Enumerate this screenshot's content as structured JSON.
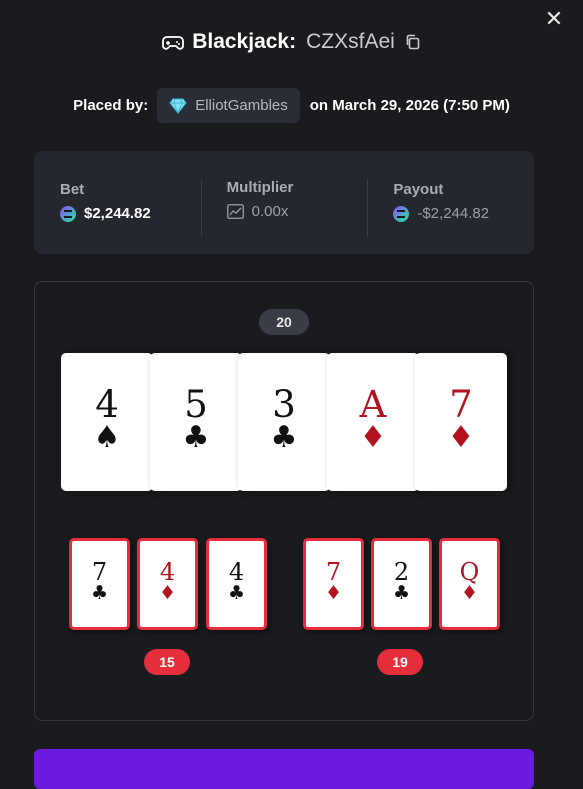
{
  "title": {
    "game": "Blackjack:",
    "id": "CZXsfAei"
  },
  "placed": {
    "prefix": "Placed by:",
    "user": "ElliotGambles",
    "date": "on March 29, 2026 (7:50 PM)"
  },
  "stats": {
    "bet_label": "Bet",
    "bet_value": "$2,244.82",
    "multiplier_label": "Multiplier",
    "multiplier_value": "0.00x",
    "payout_label": "Payout",
    "payout_value": "-$2,244.82"
  },
  "dealer": {
    "total": "20",
    "cards": [
      {
        "rank": "4",
        "suit": "♠",
        "color": "black"
      },
      {
        "rank": "5",
        "suit": "♣",
        "color": "black"
      },
      {
        "rank": "3",
        "suit": "♣",
        "color": "black"
      },
      {
        "rank": "A",
        "suit": "♦",
        "color": "red"
      },
      {
        "rank": "7",
        "suit": "♦",
        "color": "red"
      }
    ]
  },
  "hands": [
    {
      "total": "15",
      "cards": [
        {
          "rank": "7",
          "suit": "♣",
          "color": "black"
        },
        {
          "rank": "4",
          "suit": "♦",
          "color": "red"
        },
        {
          "rank": "4",
          "suit": "♣",
          "color": "black"
        }
      ]
    },
    {
      "total": "19",
      "cards": [
        {
          "rank": "7",
          "suit": "♦",
          "color": "red"
        },
        {
          "rank": "2",
          "suit": "♣",
          "color": "black"
        },
        {
          "rank": "Q",
          "suit": "♦",
          "color": "red"
        }
      ]
    }
  ],
  "colors": {
    "accent": "#6b1be0",
    "loss": "#e52d3b",
    "panel": "#24272e",
    "background": "#1a1b1f"
  },
  "icons": {
    "close": "close-icon",
    "game": "gamepad-icon",
    "copy": "copy-icon",
    "user_badge": "diamond-gem-icon",
    "currency": "solana-coin-icon",
    "multiplier": "chart-icon"
  }
}
